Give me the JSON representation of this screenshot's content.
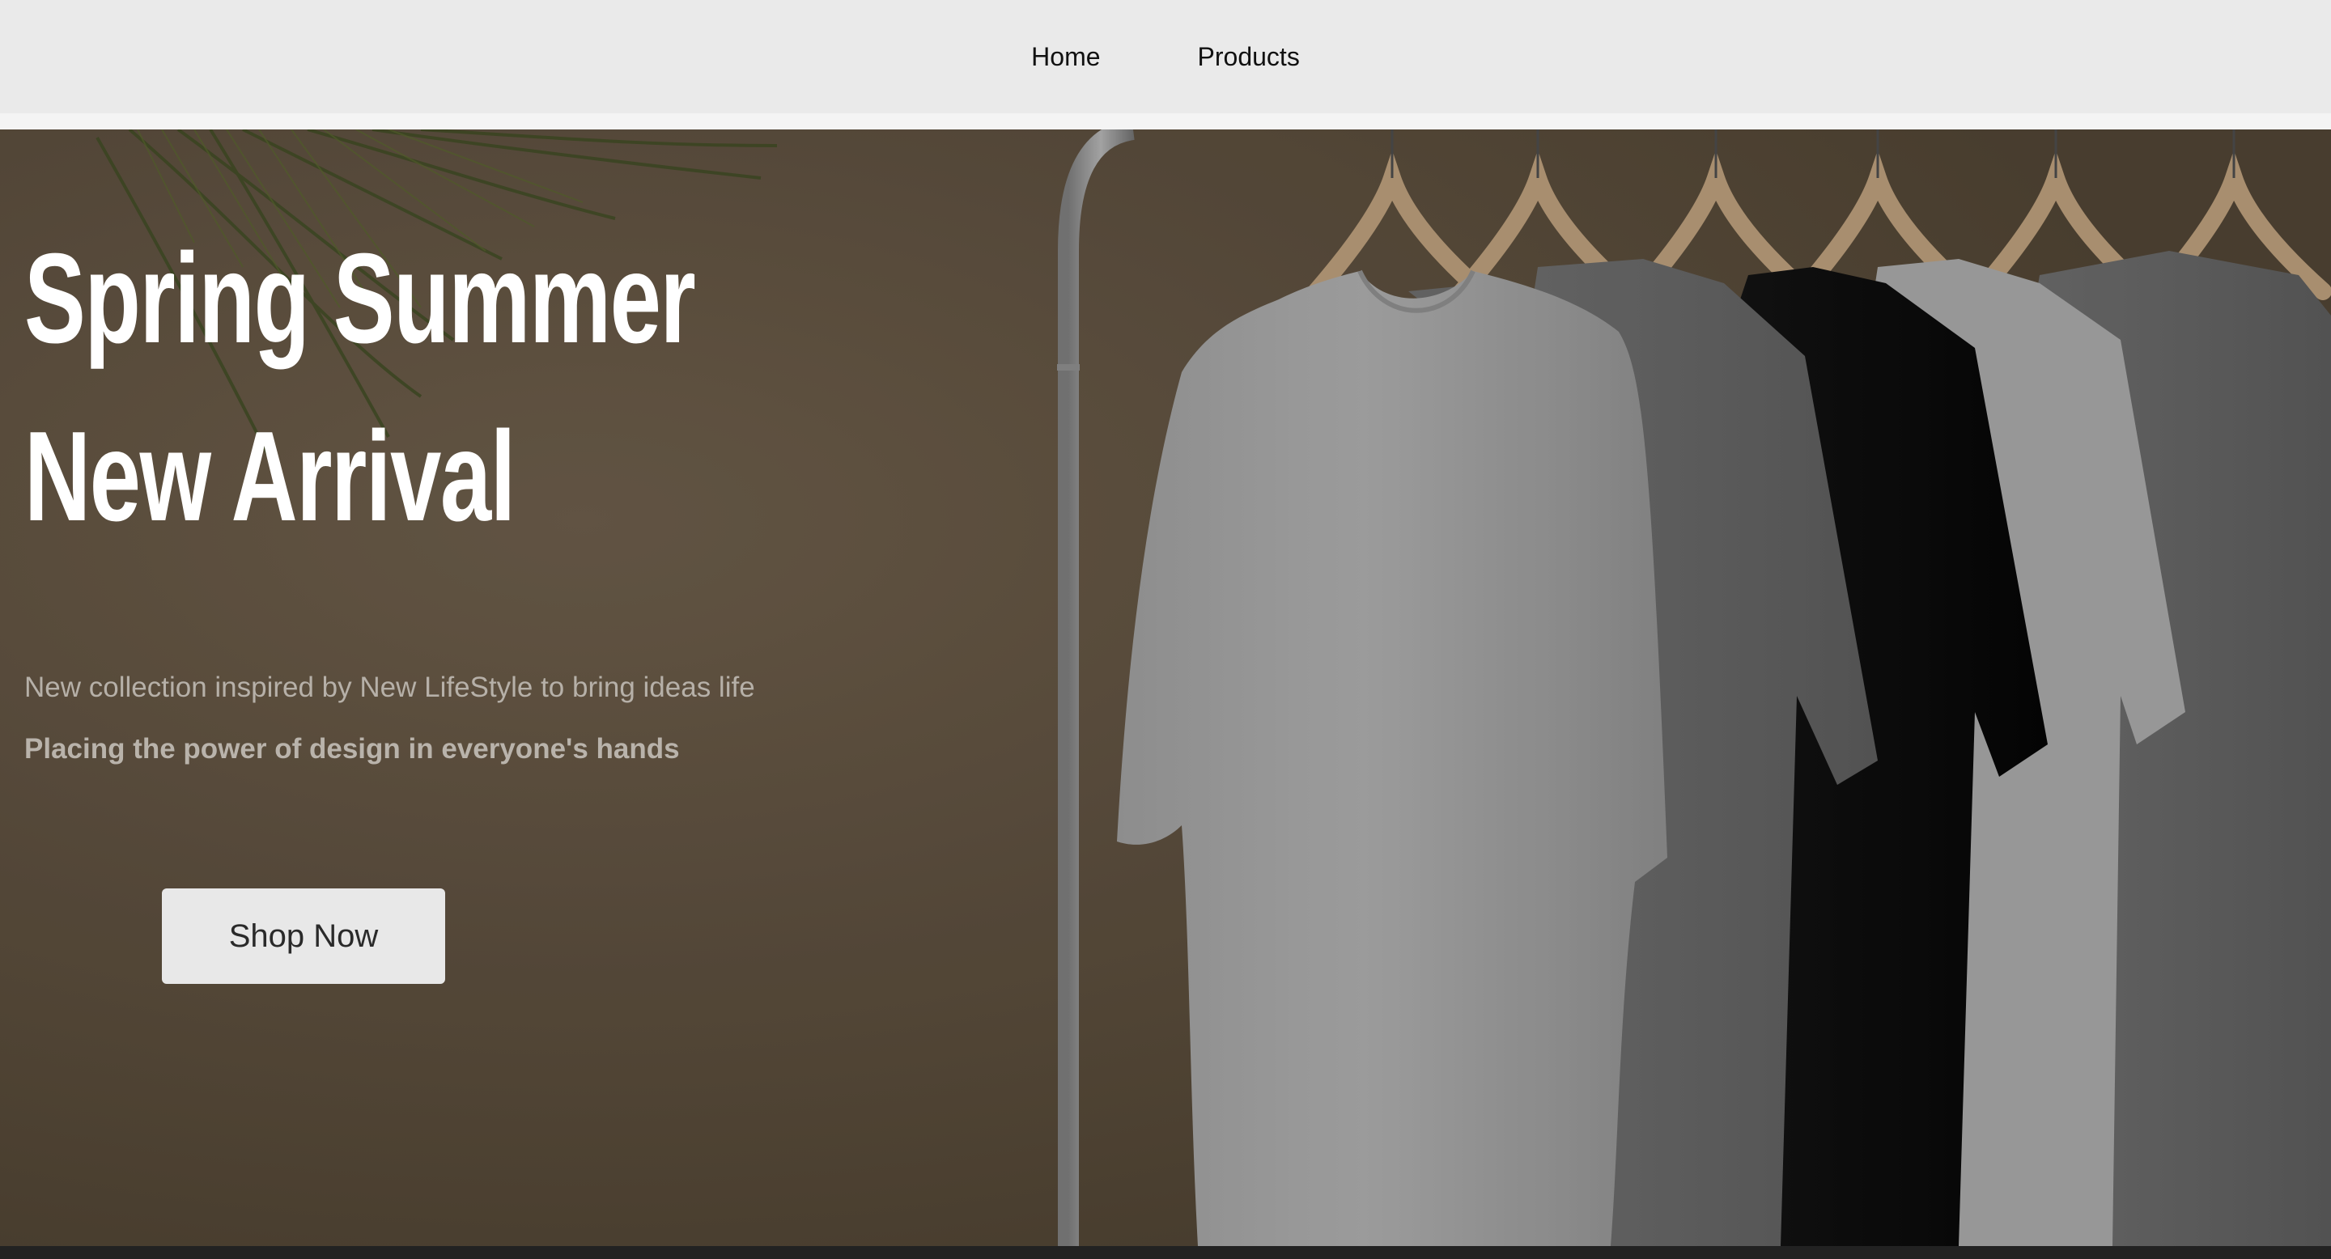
{
  "nav": {
    "items": [
      {
        "label": "Home"
      },
      {
        "label": "Products"
      }
    ]
  },
  "hero": {
    "title_line1": "Spring Summer",
    "title_line2": "New Arrival",
    "subtitle": "New collection inspired by New LifeStyle to bring ideas life",
    "tagline": "Placing the power of design in everyone's hands",
    "cta_label": "Shop Now"
  },
  "colors": {
    "nav_bg": "#eaeaea",
    "hero_bg": "#5b4d3d",
    "cta_bg": "#e8e8e8",
    "footer_bar": "#222222"
  },
  "icons": [
    "palm-leaf-decoration",
    "clothing-rack",
    "t-shirt-white",
    "t-shirt-grey",
    "t-shirt-black",
    "wooden-hanger"
  ]
}
